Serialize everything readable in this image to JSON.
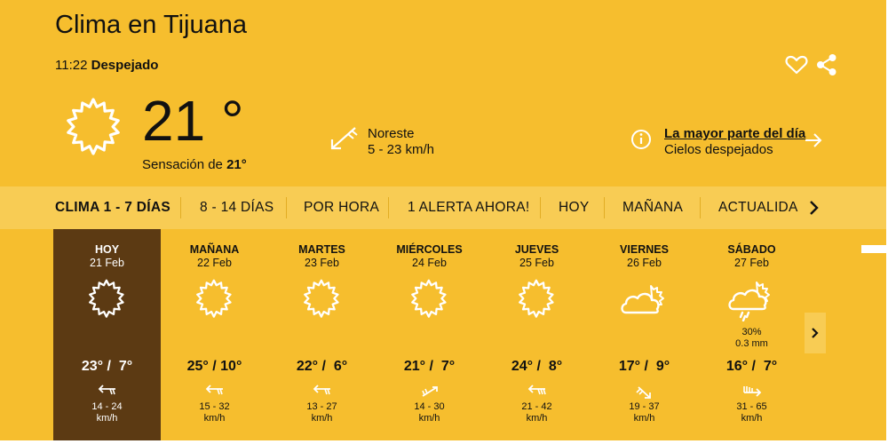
{
  "header": {
    "title": "Clima en Tijuana",
    "time": "11:22",
    "condition": "Despejado",
    "favorite_icon": "heart-icon",
    "share_icon": "share-icon"
  },
  "current": {
    "temperature": "21 °",
    "feels_label": "Sensación de",
    "feels_value": "21°",
    "weather_icon": "sun-icon",
    "wind_direction": "Noreste",
    "wind_speed": "5 - 23 km/h",
    "summary_title": "La mayor parte del día",
    "summary_text": "Cielos despejados"
  },
  "tabs": [
    {
      "label": "CLIMA 1 - 7 DÍAS",
      "active": true
    },
    {
      "label": "8 - 14 DÍAS"
    },
    {
      "label": "POR HORA"
    },
    {
      "label": "1 ALERTA AHORA!"
    },
    {
      "label": "HOY"
    },
    {
      "label": "MAÑANA"
    },
    {
      "label": "ACTUALIDAD"
    }
  ],
  "days": [
    {
      "name": "HOY",
      "date": "21 Feb",
      "icon": "sun-icon",
      "temps": "23° /  7°",
      "wind_speed": "14 - 24",
      "wind_unit": "km/h",
      "active": true
    },
    {
      "name": "MAÑANA",
      "date": "22 Feb",
      "icon": "sun-icon",
      "temps": "25° / 10°",
      "wind_speed": "15 - 32",
      "wind_unit": "km/h"
    },
    {
      "name": "MARTES",
      "date": "23 Feb",
      "icon": "sun-icon",
      "temps": "22° /  6°",
      "wind_speed": "13 - 27",
      "wind_unit": "km/h"
    },
    {
      "name": "MIÉRCOLES",
      "date": "24 Feb",
      "icon": "sun-icon",
      "temps": "21° /  7°",
      "wind_speed": "14 - 30",
      "wind_unit": "km/h"
    },
    {
      "name": "JUEVES",
      "date": "25 Feb",
      "icon": "sun-icon",
      "temps": "24° /  8°",
      "wind_speed": "21 - 42",
      "wind_unit": "km/h"
    },
    {
      "name": "VIERNES",
      "date": "26 Feb",
      "icon": "partly-cloudy-icon",
      "temps": "17° /  9°",
      "wind_speed": "19 - 37",
      "wind_unit": "km/h"
    },
    {
      "name": "SÁBADO",
      "date": "27 Feb",
      "icon": "rain-cloud-icon",
      "precip_prob": "30%",
      "precip_amount": "0.3 mm",
      "temps": "16° /  7°",
      "wind_speed": "31 - 65",
      "wind_unit": "km/h"
    }
  ],
  "colors": {
    "background": "#f6be2e",
    "tab_bar": "#f8cc54",
    "active_day": "#5c3a13"
  }
}
